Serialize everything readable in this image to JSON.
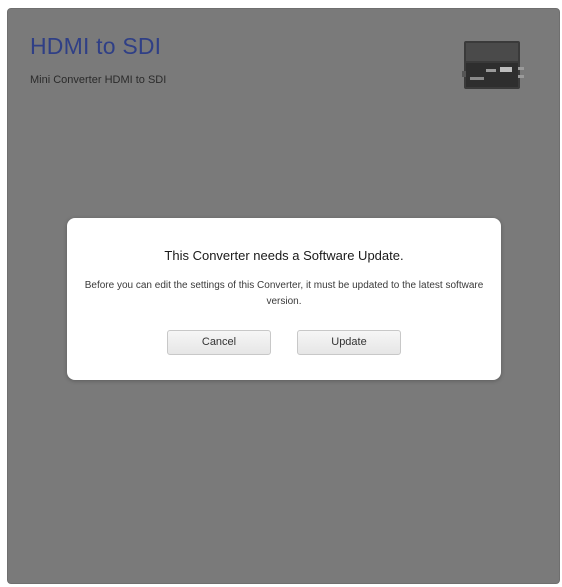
{
  "header": {
    "title": "HDMI to SDI",
    "subtitle": "Mini Converter HDMI to SDI",
    "device_image": "mini-converter-device"
  },
  "dialog": {
    "title": "This Converter needs a Software Update.",
    "message": "Before you can edit the settings of this Converter, it must be updated to the latest software version.",
    "cancel_label": "Cancel",
    "update_label": "Update"
  },
  "colors": {
    "background": "#7a7a7a",
    "title": "#2f3f86",
    "dialog": "#ffffff"
  }
}
